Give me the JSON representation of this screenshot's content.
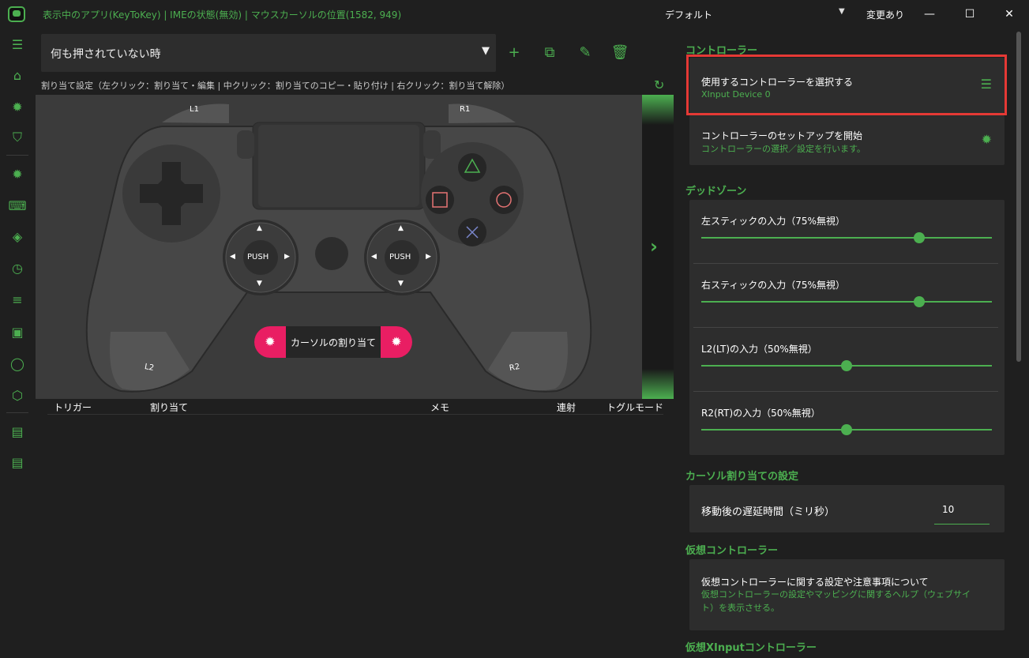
{
  "titlebar": {
    "status": "表示中のアプリ(KeyToKey)  |  IMEの状態(無効)  |  マウスカーソルの位置(1582, 949)",
    "profile": "デフォルト",
    "changed": "変更あり",
    "minimize": "—",
    "maximize": "☐",
    "close": "✕"
  },
  "toolbar": {
    "mode_select": "何も押されていない時",
    "caret": "▼",
    "hint": "割り当て設定（左クリック：割り当て・編集  |  中クリック：割り当てのコピー・貼り付け  |  右クリック：割り当て解除）"
  },
  "controller": {
    "l1": "L1",
    "r1": "R1",
    "l2": "L2",
    "r2": "R2",
    "push_left": "PUSH",
    "push_right": "PUSH",
    "cursor_assign": "カーソルの割り当て"
  },
  "table": {
    "headers": [
      "トリガー",
      "割り当て",
      "メモ",
      "連射",
      "トグルモード"
    ]
  },
  "panel": {
    "sec_controller": "コントローラー",
    "select_controller_title": "使用するコントローラーを選択する",
    "select_controller_sub": "XInput Device 0",
    "setup_title": "コントローラーのセットアップを開始",
    "setup_sub": "コントローラーの選択／設定を行います。",
    "sec_deadzone": "デッドゾーン",
    "sliders": [
      {
        "label": "左スティックの入力（75%無視）",
        "value": 0.75
      },
      {
        "label": "右スティックの入力（75%無視）",
        "value": 0.75
      },
      {
        "label": "L2(LT)の入力（50%無視）",
        "value": 0.5
      },
      {
        "label": "R2(RT)の入力（50%無視）",
        "value": 0.5
      }
    ],
    "sec_cursor": "カーソル割り当ての設定",
    "delay_label": "移動後の遅延時間（ミリ秒）",
    "delay_value": "10",
    "sec_virtual": "仮想コントローラー",
    "virtual_title": "仮想コントローラーに関する設定や注意事項について",
    "virtual_sub": "仮想コントローラーの設定やマッピングに関するヘルプ（ウェブサイト）を表示させる。",
    "sec_virtual_xinput": "仮想XInputコントローラー"
  },
  "colors": {
    "accent": "#4caf50",
    "pink": "#e91e63",
    "highlight": "#e53935"
  }
}
